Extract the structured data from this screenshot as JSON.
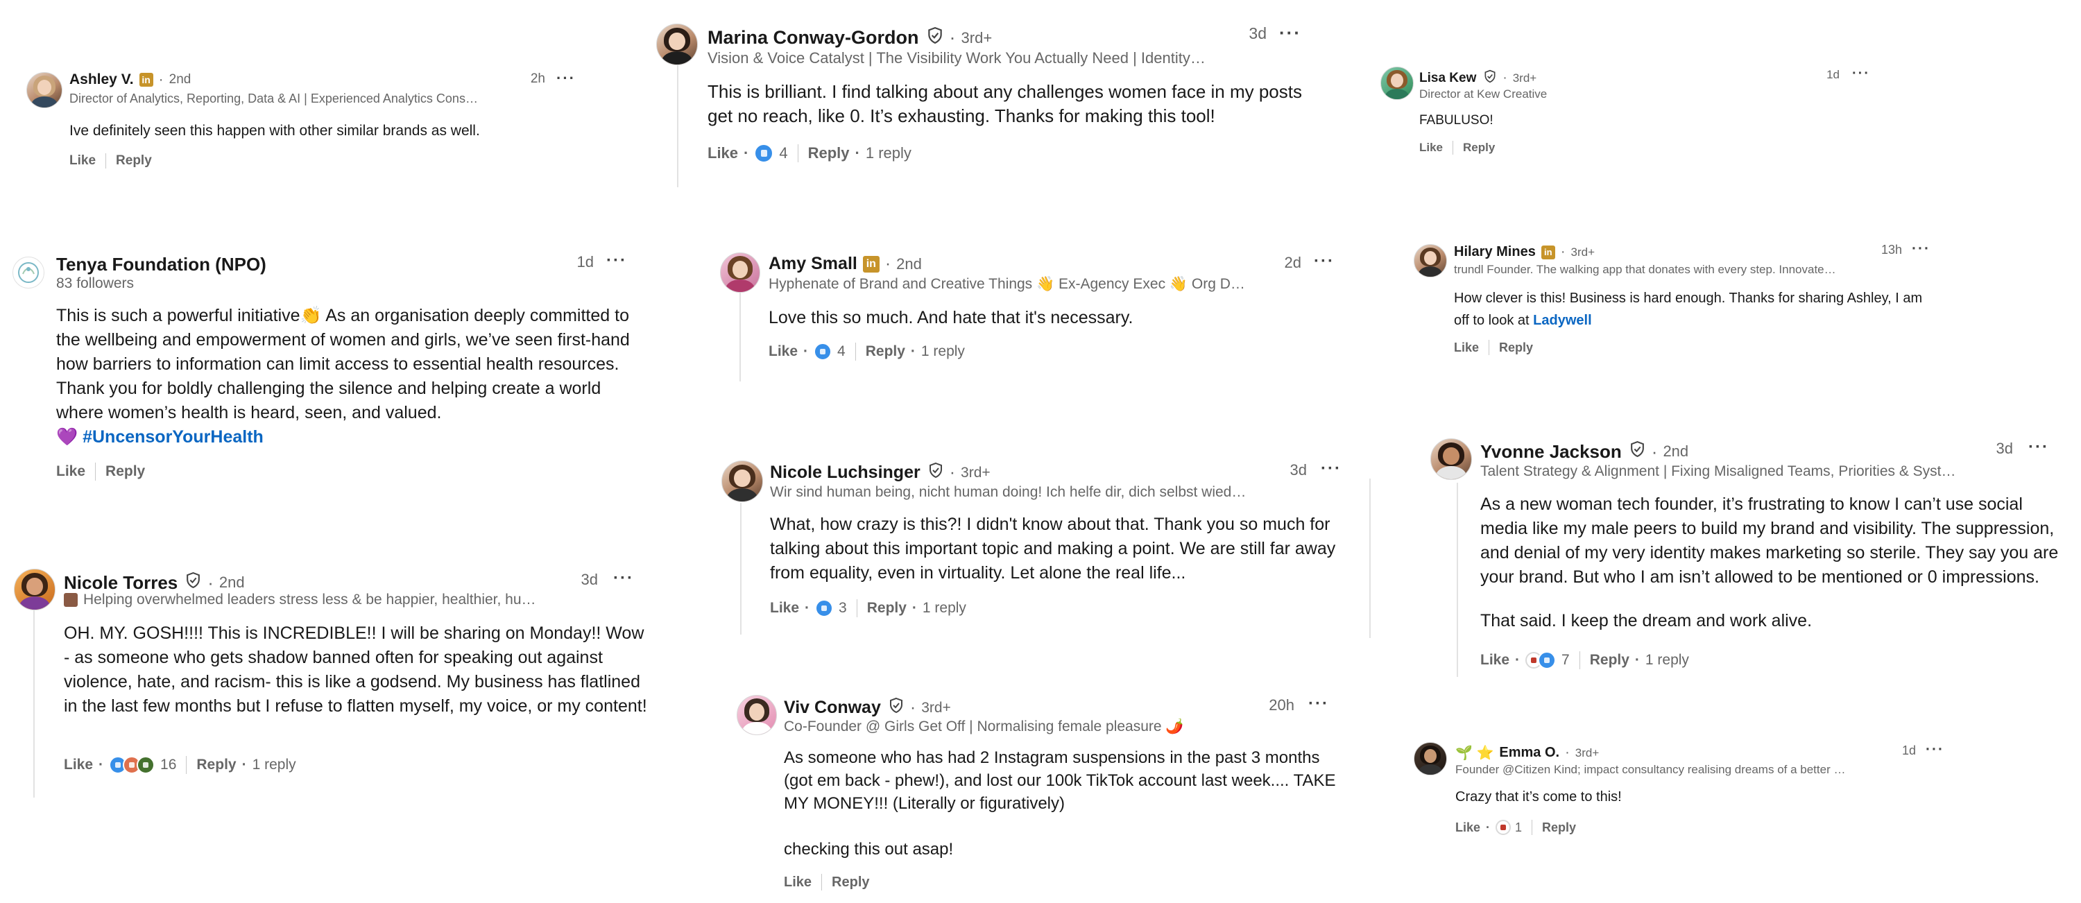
{
  "ui": {
    "like": "Like",
    "reply": "Reply",
    "dot": "·",
    "more": "···"
  },
  "colors": {
    "text": "#191919",
    "secondary": "#666666",
    "link": "#0a66c2",
    "premium": "#c7942a",
    "like_blue": "#378fe9",
    "thread_line": "#e2e2e2"
  },
  "comments": [
    {
      "name": "Ashley V.",
      "badge": "in",
      "degree": "2nd",
      "headline": "Director of Analytics, Reporting, Data & AI | Experienced Analytics Cons…",
      "time": "2h",
      "body": [
        "Ive definitely seen this happen with other similar brands as well."
      ],
      "reactions": null,
      "reaction_count": "",
      "replies": ""
    },
    {
      "name": "Marina Conway-Gordon",
      "verified": true,
      "degree": "3rd+",
      "headline": "Vision & Voice Catalyst | The Visibility Work You Actually Need | Identity…",
      "time": "3d",
      "body": [
        "This is brilliant. I find talking about any challenges women face in my posts get no reach, like 0. It’s exhausting. Thanks for making this tool!"
      ],
      "reactions": [
        "like-icon"
      ],
      "reaction_count": "4",
      "replies": "1 reply"
    },
    {
      "name": "Lisa Kew",
      "verified": true,
      "degree": "3rd+",
      "headline": "Director at Kew Creative",
      "time": "1d",
      "body": [
        "FABULUSO!"
      ],
      "reactions": null,
      "reaction_count": "",
      "replies": ""
    },
    {
      "name": "Tenya Foundation (NPO)",
      "followers": "83 followers",
      "time": "1d",
      "body": [
        "This is such a powerful initiative👏 As an organisation deeply committed to the wellbeing and empowerment of women and girls, we’ve seen first-hand how barriers to information can limit access to essential health resources. Thank you for boldly challenging the silence and helping create a world where women’s health is heard, seen, and valued."
      ],
      "hashtag_prefix": "💜",
      "hashtag": "#UncensorYourHealth",
      "reactions": null,
      "reaction_count": "",
      "replies": ""
    },
    {
      "name": "Amy Small",
      "badge": "in",
      "degree": "2nd",
      "headline": "Hyphenate of Brand and Creative Things 👋 Ex-Agency Exec 👋 Org D…",
      "time": "2d",
      "body": [
        "Love this so much. And hate that it's necessary."
      ],
      "reactions": [
        "like-icon"
      ],
      "reaction_count": "4",
      "replies": "1 reply"
    },
    {
      "name": "Hilary Mines",
      "badge": "in",
      "degree": "3rd+",
      "headline": "trundl Founder. The walking app that donates with every step. Innovate…",
      "time": "13h",
      "body": [
        "How clever is this! Business is hard enough. Thanks for sharing Ashley, I am off to look at"
      ],
      "link": "Ladywell",
      "reactions": null,
      "reaction_count": "",
      "replies": ""
    },
    {
      "name": "Nicole Luchsinger",
      "verified": true,
      "degree": "3rd+",
      "headline": "Wir sind human being, nicht human doing! Ich helfe dir, dich selbst wied…",
      "time": "3d",
      "body": [
        "What, how crazy is this?! I didn't know about that. Thank you so much for talking about this important topic and making a point. We are still far away from equality, even in virtuality. Let alone the real life..."
      ],
      "reactions": [
        "like-icon"
      ],
      "reaction_count": "3",
      "replies": "1 reply"
    },
    {
      "name": "Yvonne Jackson",
      "verified": true,
      "degree": "2nd",
      "headline": "Talent Strategy & Alignment | Fixing Misaligned Teams, Priorities & Syst…",
      "time": "3d",
      "body": [
        "As a new woman tech founder, it’s frustrating to know I can’t use social media like my male peers to build my brand and visibility. The suppression, and denial of my very identity makes marketing so sterile. They say you are your brand. But who I am isn’t allowed to be mentioned or 0 impressions.",
        "That said. I keep the dream and work alive."
      ],
      "reactions": [
        "flag-icon",
        "like-icon"
      ],
      "reaction_count": "7",
      "replies": "1 reply"
    },
    {
      "name": "Nicole Torres",
      "verified": true,
      "degree": "2nd",
      "headline": "Helping overwhelmed leaders stress less & be happier, healthier, hu…",
      "time": "3d",
      "body": [
        "OH. MY. GOSH!!!! This is INCREDIBLE!! I will be sharing on Monday!! Wow - as someone who gets shadow banned often for speaking out against violence, hate, and racism- this is like a godsend. My business has flatlined in the last few months but I refuse to flatten myself, my voice, or my content!"
      ],
      "reactions": [
        "like-icon",
        "love-icon",
        "celebrate-icon"
      ],
      "reaction_count": "16",
      "replies": "1 reply"
    },
    {
      "name": "Viv Conway",
      "verified": true,
      "degree": "3rd+",
      "headline": "Co-Founder @ Girls Get Off | Normalising female pleasure 🌶️",
      "time": "20h",
      "body": [
        "As someone who has had 2 Instagram suspensions in the past 3 months (got em back - phew!), and lost our 100k TikTok account last week.... TAKE MY MONEY!!! (Literally or figuratively)",
        "checking this out asap!"
      ],
      "reactions": null,
      "reaction_count": "",
      "replies": ""
    },
    {
      "name": "Emma O.",
      "name_prefix": "🌱 ⭐",
      "degree": "3rd+",
      "headline": "Founder @Citizen Kind; impact consultancy realising dreams of a better …",
      "time": "1d",
      "body": [
        "Crazy that it’s come to this!"
      ],
      "reactions": [
        "flag-icon"
      ],
      "reaction_count": "1",
      "replies": ""
    }
  ]
}
